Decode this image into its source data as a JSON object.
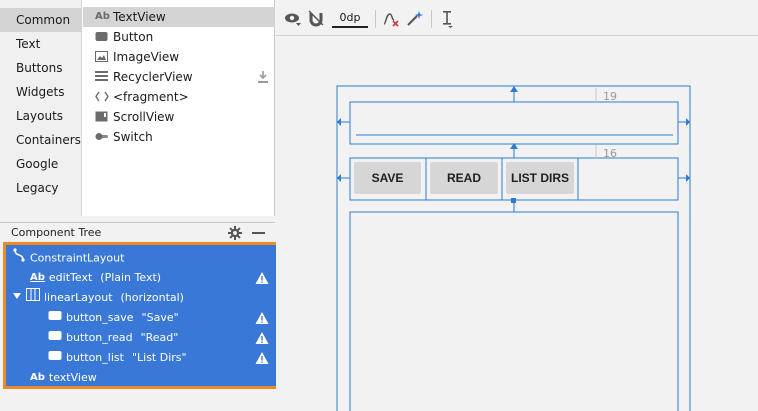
{
  "palette": {
    "categories": [
      "Common",
      "Text",
      "Buttons",
      "Widgets",
      "Layouts",
      "Containers",
      "Google",
      "Legacy"
    ],
    "selected_category": "Common",
    "widgets": [
      {
        "label": "TextView",
        "icon": "textview-icon"
      },
      {
        "label": "Button",
        "icon": "button-icon"
      },
      {
        "label": "ImageView",
        "icon": "imageview-icon"
      },
      {
        "label": "RecyclerView",
        "icon": "recyclerview-icon"
      },
      {
        "label": "<fragment>",
        "icon": "fragment-icon"
      },
      {
        "label": "ScrollView",
        "icon": "scrollview-icon"
      },
      {
        "label": "Switch",
        "icon": "switch-icon"
      }
    ],
    "textview_icon_text": "Ab"
  },
  "component_tree": {
    "title": "Component Tree",
    "nodes": [
      {
        "name": "ConstraintLayout",
        "detail": "",
        "icon": "constraint-layout-icon",
        "warning": false
      },
      {
        "name": "editText",
        "detail": "(Plain Text)",
        "icon": "edittext-icon",
        "warning": true
      },
      {
        "name": "linearLayout",
        "detail": "(horizontal)",
        "icon": "linear-layout-icon",
        "warning": false
      },
      {
        "name": "button_save",
        "detail": "\"Save\"",
        "icon": "button-icon",
        "warning": true
      },
      {
        "name": "button_read",
        "detail": "\"Read\"",
        "icon": "button-icon",
        "warning": true
      },
      {
        "name": "button_list",
        "detail": "\"List Dirs\"",
        "icon": "button-icon",
        "warning": true
      },
      {
        "name": "textView",
        "detail": "",
        "icon": "textview-icon",
        "warning": false
      }
    ]
  },
  "toolbar": {
    "default_margin": "0dp"
  },
  "canvas": {
    "buttons": [
      "SAVE",
      "READ",
      "LIST DIRS"
    ],
    "margin_top_edittext": "19",
    "margin_top_linear": "16"
  },
  "colors": {
    "selection": "#3a78d8",
    "highlight_border": "#f08a24",
    "blueprint": "#2f7bd1",
    "warning": "#ffffff"
  }
}
